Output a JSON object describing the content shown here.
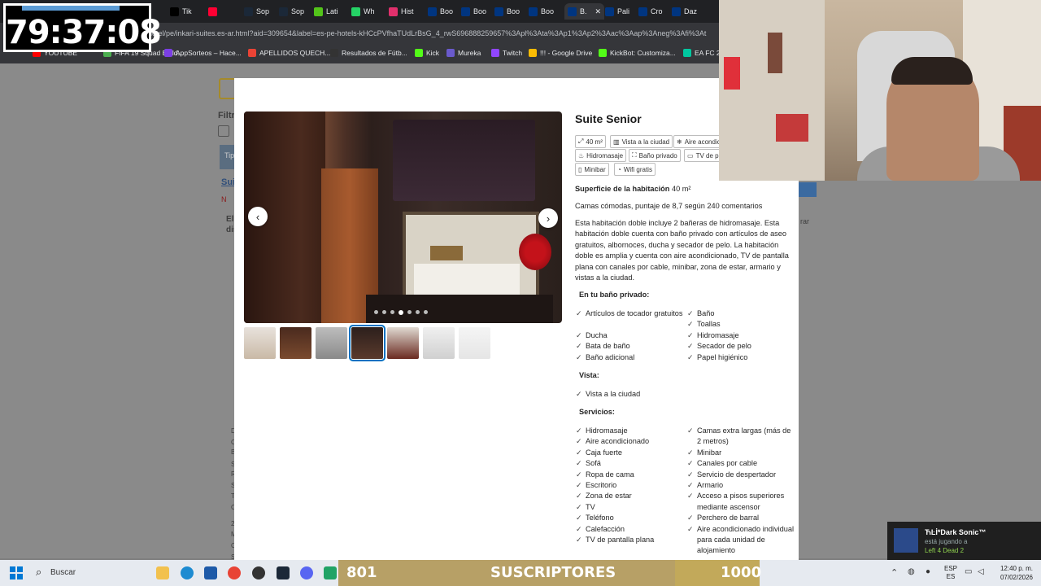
{
  "timer": "79:37:08",
  "browser": {
    "tabs": [
      {
        "label": "Tik",
        "color": "#000"
      },
      {
        "label": "",
        "color": "#ff0033"
      },
      {
        "label": "Sop",
        "color": "#1b2838"
      },
      {
        "label": "Sop",
        "color": "#1b2838"
      },
      {
        "label": "Lati",
        "color": "#53c41a"
      },
      {
        "label": "Wh",
        "color": "#25d366"
      },
      {
        "label": "Hist",
        "color": "#e1306c"
      },
      {
        "label": "Boo",
        "color": "#003580"
      },
      {
        "label": "Boo",
        "color": "#003580"
      },
      {
        "label": "Boo",
        "color": "#003580"
      },
      {
        "label": "Boo",
        "color": "#003580"
      },
      {
        "label": "B.",
        "color": "#003580"
      },
      {
        "label": "Pali",
        "color": "#003580"
      },
      {
        "label": "Cro",
        "color": "#003580"
      },
      {
        "label": "Daz",
        "color": "#003580"
      }
    ],
    "url": ".com/hotel/pe/inkari-suites.es-ar.html?aid=309654&label=es-pe-hotels-kHCcPVfhaTUdLrBsG_4_rwS696888259657%3Apl%3Ata%3Ap1%3Ap2%3Aac%3Aap%3Aneg%3Afi%3At",
    "bookmarks": [
      {
        "label": "YOUTUBE",
        "color": "#ff0000"
      },
      {
        "label": "FIFA 19 Squad Build...",
        "color": "#4caf50"
      },
      {
        "label": "AppSorteos – Hace...",
        "color": "#7b3fe4"
      },
      {
        "label": "APELLIDOS QUECH...",
        "color": "#ea4335"
      },
      {
        "label": "Resultados de Fútb...",
        "color": "#333"
      },
      {
        "label": "Kick",
        "color": "#53fc18"
      },
      {
        "label": "Mureka",
        "color": "#6a5acd"
      },
      {
        "label": "Twitch",
        "color": "#9146ff"
      },
      {
        "label": "!!! - Google Drive",
        "color": "#fbbc04"
      },
      {
        "label": "KickBot: Customiza...",
        "color": "#53fc18"
      },
      {
        "label": "EA FC 26",
        "color": "#00c8a0"
      }
    ]
  },
  "background": {
    "filter_label": "Filtr",
    "tip_label": "Tip",
    "sui_label": "Sui",
    "n_label": "N",
    "el_label": "El",
    "dis_label": "dis",
    "rar_label": "rar",
    "left_items": [
      "D",
      "C",
      "B",
      "S",
      "R",
      "S",
      "Te",
      "C",
      "2 me",
      "M",
      "C",
      "S",
      "C",
      "C"
    ]
  },
  "modal": {
    "room_title": "Suite Senior",
    "chips": [
      "40 m²",
      "Vista a la ciudad",
      "Aire acondicionado",
      "Hidromasaje",
      "Baño privado",
      "TV de pantalla plana",
      "Minibar",
      "Wifi gratis"
    ],
    "area_label": "Superficie de la habitación",
    "area_value": "40 m²",
    "beds_text": "Camas cómodas, puntaje de 8,7 según 240 comentarios",
    "description": "Esta habitación doble incluye 2 bañeras de hidromasaje. Esta habitación doble cuenta con baño privado con artículos de aseo gratuitos, albornoces, ducha y secador de pelo. La habitación doble es amplia y cuenta con aire acondicionado, TV de pantalla plana con canales por cable, minibar, zona de estar, armario y vistas a la ciudad.",
    "bathroom_heading": "En tu baño privado:",
    "bathroom_col1": [
      "Artículos de tocador gratuitos",
      "Ducha",
      "Bata de baño",
      "Baño adicional"
    ],
    "bathroom_col2": [
      "Baño",
      "Toallas",
      "Hidromasaje",
      "Secador de pelo",
      "Papel higiénico"
    ],
    "view_heading": "Vista:",
    "view_items": [
      "Vista a la ciudad"
    ],
    "services_heading": "Servicios:",
    "services_col1": [
      "Hidromasaje",
      "Aire acondicionado",
      "Caja fuerte",
      "Sofá",
      "Ropa de cama",
      "Escritorio",
      "Zona de estar",
      "TV",
      "Teléfono",
      "Calefacción",
      "TV de pantalla plana"
    ],
    "services_col2": [
      "Camas extra largas (más de 2 metros)",
      "Minibar",
      "Canales por cable",
      "Servicio de despertador",
      "Armario",
      "Acceso a pisos superiores mediante ascensor",
      "Perchero de barral",
      "Aire acondicionado individual para cada unidad de alojamiento"
    ],
    "photo_count": 7,
    "active_photo": 4
  },
  "notification": {
    "name": "ЋĿİ*Dark Sonic™",
    "status": "está jugando a",
    "game": "Left 4 Dead 2"
  },
  "subs_bar": {
    "current": "801",
    "label": "SUSCRIPTORES",
    "goal": "1000",
    "progress": 0.8
  },
  "taskbar": {
    "search_placeholder": "Buscar",
    "lang_top": "ESP",
    "lang_bottom": "ES",
    "time": "12:40 p. m.",
    "date": "07/02/2026"
  }
}
